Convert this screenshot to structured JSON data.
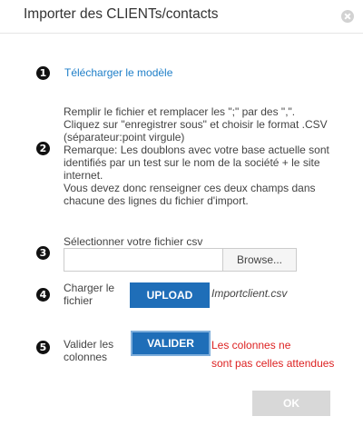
{
  "dialog": {
    "title": "Importer des CLIENTs/contacts",
    "close_icon": "close-icon"
  },
  "step1": {
    "number": "1",
    "link_label": "Télécharger le modèle"
  },
  "step2": {
    "number": "2",
    "lines": [
      "Remplir le fichier et remplacer les \";\" par des \",\".",
      "Cliquez sur \"enregistrer sous\" et choisir le format .CSV",
      "(séparateur:point virgule)",
      "Remarque: Les doublons avec votre base actuelle sont",
      "identifiés par un test sur le nom de la société + le site",
      "internet.",
      "Vous devez donc renseigner ces deux champs dans",
      "chacune des lignes du fichier d'import."
    ]
  },
  "step3": {
    "number": "3",
    "label": "Sélectionner votre fichier csv",
    "file_value": "",
    "browse_label": "Browse..."
  },
  "step4": {
    "number": "4",
    "label_line1": "Charger le",
    "label_line2": "fichier",
    "upload_label": "UPLOAD",
    "filename": "Importclient.csv"
  },
  "step5": {
    "number": "5",
    "label_line1": "Valider les",
    "label_line2": "colonnes",
    "validate_label": "VALIDER",
    "error_line1": "Les colonnes ne",
    "error_line2": "sont pas celles attendues"
  },
  "footer": {
    "ok_label": "OK"
  },
  "colors": {
    "accent": "#1f6eb8",
    "link": "#1f7fc8",
    "error": "#dd2222",
    "disabled": "#d8d8d8"
  }
}
